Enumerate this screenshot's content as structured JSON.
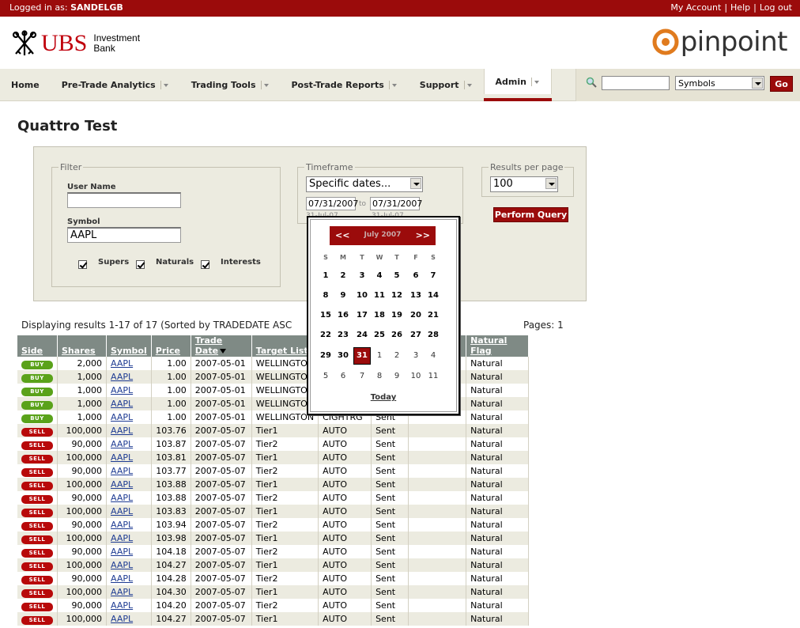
{
  "topbar": {
    "login_prefix": "Logged in as:",
    "username": "SANDELGB",
    "my_account": "My Account",
    "help": "Help",
    "logout": "Log out",
    "sep": "|"
  },
  "brand": {
    "ubs": "UBS",
    "ubs_sub_1": "Investment",
    "ubs_sub_2": "Bank",
    "product": "pinpoint"
  },
  "nav": {
    "items": [
      {
        "label": "Home",
        "dropdown": false
      },
      {
        "label": "Pre-Trade Analytics",
        "dropdown": true
      },
      {
        "label": "Trading Tools",
        "dropdown": true
      },
      {
        "label": "Post-Trade Reports",
        "dropdown": true
      },
      {
        "label": "Support",
        "dropdown": true
      },
      {
        "label": "Admin",
        "dropdown": true,
        "active": true
      }
    ],
    "search_value": "",
    "search_type": "Symbols",
    "go_label": "Go"
  },
  "page": {
    "title": "Quattro Test"
  },
  "filter": {
    "legend": "Filter",
    "user_label": "User Name",
    "user_value": "",
    "symbol_label": "Symbol",
    "symbol_value": "AAPL",
    "supers_label": "Supers",
    "naturals_label": "Naturals",
    "interests_label": "Interests"
  },
  "timeframe": {
    "legend": "Timeframe",
    "mode": "Specific dates...",
    "from": "07/31/2007",
    "to_label": "to",
    "to": "07/31/2007",
    "from_hint": "31-Jul-07",
    "to_hint": "31-Jul-07"
  },
  "rpp": {
    "legend": "Results per page",
    "value": "100"
  },
  "perform_query": "Perform Query",
  "results": {
    "info": "Displaying results 1-17 of 17   (Sorted by TRADEDATE ASC",
    "pages": "Pages: 1"
  },
  "table": {
    "headers": [
      "Side",
      "Shares",
      "Symbol",
      "Price",
      "Trade Date",
      "Target List",
      "",
      "",
      "",
      "Natural Flag"
    ],
    "rows": [
      {
        "side": "BUY",
        "shares": "2,000",
        "symbol": "AAPL",
        "price": "1.00",
        "date": "2007-05-01",
        "target": "WELLINGTON",
        "c6": "",
        "c7": "",
        "c8": "",
        "flag": "Natural"
      },
      {
        "side": "BUY",
        "shares": "1,000",
        "symbol": "AAPL",
        "price": "1.00",
        "date": "2007-05-01",
        "target": "WELLINGTON",
        "c6": "",
        "c7": "",
        "c8": "",
        "flag": "Natural"
      },
      {
        "side": "BUY",
        "shares": "1,000",
        "symbol": "AAPL",
        "price": "1.00",
        "date": "2007-05-01",
        "target": "WELLINGTON",
        "c6": "",
        "c7": "",
        "c8": "",
        "flag": "Natural"
      },
      {
        "side": "BUY",
        "shares": "1,000",
        "symbol": "AAPL",
        "price": "1.00",
        "date": "2007-05-01",
        "target": "WELLINGTON",
        "c6": "",
        "c7": "",
        "c8": "",
        "flag": "Natural"
      },
      {
        "side": "BUY",
        "shares": "1,000",
        "symbol": "AAPL",
        "price": "1.00",
        "date": "2007-05-01",
        "target": "WELLINGTON",
        "c6": "CIGHTRG",
        "c7": "Sent",
        "c8": "",
        "flag": "Natural"
      },
      {
        "side": "SELL",
        "shares": "100,000",
        "symbol": "AAPL",
        "price": "103.76",
        "date": "2007-05-07",
        "target": "Tier1",
        "c6": "AUTO",
        "c7": "Sent",
        "c8": "",
        "flag": "Natural"
      },
      {
        "side": "SELL",
        "shares": "90,000",
        "symbol": "AAPL",
        "price": "103.87",
        "date": "2007-05-07",
        "target": "Tier2",
        "c6": "AUTO",
        "c7": "Sent",
        "c8": "",
        "flag": "Natural"
      },
      {
        "side": "SELL",
        "shares": "100,000",
        "symbol": "AAPL",
        "price": "103.81",
        "date": "2007-05-07",
        "target": "Tier1",
        "c6": "AUTO",
        "c7": "Sent",
        "c8": "",
        "flag": "Natural"
      },
      {
        "side": "SELL",
        "shares": "90,000",
        "symbol": "AAPL",
        "price": "103.77",
        "date": "2007-05-07",
        "target": "Tier2",
        "c6": "AUTO",
        "c7": "Sent",
        "c8": "",
        "flag": "Natural"
      },
      {
        "side": "SELL",
        "shares": "100,000",
        "symbol": "AAPL",
        "price": "103.88",
        "date": "2007-05-07",
        "target": "Tier1",
        "c6": "AUTO",
        "c7": "Sent",
        "c8": "",
        "flag": "Natural"
      },
      {
        "side": "SELL",
        "shares": "90,000",
        "symbol": "AAPL",
        "price": "103.88",
        "date": "2007-05-07",
        "target": "Tier2",
        "c6": "AUTO",
        "c7": "Sent",
        "c8": "",
        "flag": "Natural"
      },
      {
        "side": "SELL",
        "shares": "100,000",
        "symbol": "AAPL",
        "price": "103.83",
        "date": "2007-05-07",
        "target": "Tier1",
        "c6": "AUTO",
        "c7": "Sent",
        "c8": "",
        "flag": "Natural"
      },
      {
        "side": "SELL",
        "shares": "90,000",
        "symbol": "AAPL",
        "price": "103.94",
        "date": "2007-05-07",
        "target": "Tier2",
        "c6": "AUTO",
        "c7": "Sent",
        "c8": "",
        "flag": "Natural"
      },
      {
        "side": "SELL",
        "shares": "100,000",
        "symbol": "AAPL",
        "price": "103.98",
        "date": "2007-05-07",
        "target": "Tier1",
        "c6": "AUTO",
        "c7": "Sent",
        "c8": "",
        "flag": "Natural"
      },
      {
        "side": "SELL",
        "shares": "90,000",
        "symbol": "AAPL",
        "price": "104.18",
        "date": "2007-05-07",
        "target": "Tier2",
        "c6": "AUTO",
        "c7": "Sent",
        "c8": "",
        "flag": "Natural"
      },
      {
        "side": "SELL",
        "shares": "100,000",
        "symbol": "AAPL",
        "price": "104.27",
        "date": "2007-05-07",
        "target": "Tier1",
        "c6": "AUTO",
        "c7": "Sent",
        "c8": "",
        "flag": "Natural"
      },
      {
        "side": "SELL",
        "shares": "90,000",
        "symbol": "AAPL",
        "price": "104.28",
        "date": "2007-05-07",
        "target": "Tier2",
        "c6": "AUTO",
        "c7": "Sent",
        "c8": "",
        "flag": "Natural"
      },
      {
        "side": "SELL",
        "shares": "100,000",
        "symbol": "AAPL",
        "price": "104.30",
        "date": "2007-05-07",
        "target": "Tier1",
        "c6": "AUTO",
        "c7": "Sent",
        "c8": "",
        "flag": "Natural"
      },
      {
        "side": "SELL",
        "shares": "90,000",
        "symbol": "AAPL",
        "price": "104.20",
        "date": "2007-05-07",
        "target": "Tier2",
        "c6": "AUTO",
        "c7": "Sent",
        "c8": "",
        "flag": "Natural"
      },
      {
        "side": "SELL",
        "shares": "100,000",
        "symbol": "AAPL",
        "price": "104.27",
        "date": "2007-05-07",
        "target": "Tier1",
        "c6": "AUTO",
        "c7": "Sent",
        "c8": "",
        "flag": "Natural"
      }
    ]
  },
  "calendar": {
    "prev": "<<",
    "next": ">>",
    "month": "July 2007",
    "dow": [
      "S",
      "M",
      "T",
      "W",
      "T",
      "F",
      "S"
    ],
    "weeks": [
      [
        "1",
        "2",
        "3",
        "4",
        "5",
        "6",
        "7"
      ],
      [
        "8",
        "9",
        "10",
        "11",
        "12",
        "13",
        "14"
      ],
      [
        "15",
        "16",
        "17",
        "18",
        "19",
        "20",
        "21"
      ],
      [
        "22",
        "23",
        "24",
        "25",
        "26",
        "27",
        "28"
      ],
      [
        "29",
        "30",
        "31",
        "1",
        "2",
        "3",
        "4"
      ],
      [
        "5",
        "6",
        "7",
        "8",
        "9",
        "10",
        "11"
      ]
    ],
    "selected": "31",
    "today": "Today"
  },
  "colors": {
    "brand_red": "#9b0b0b",
    "buy_green": "#5aa21a",
    "sell_red": "#b8090a",
    "header_gray": "#7f8a85",
    "panel_beige": "#ecebe0"
  }
}
